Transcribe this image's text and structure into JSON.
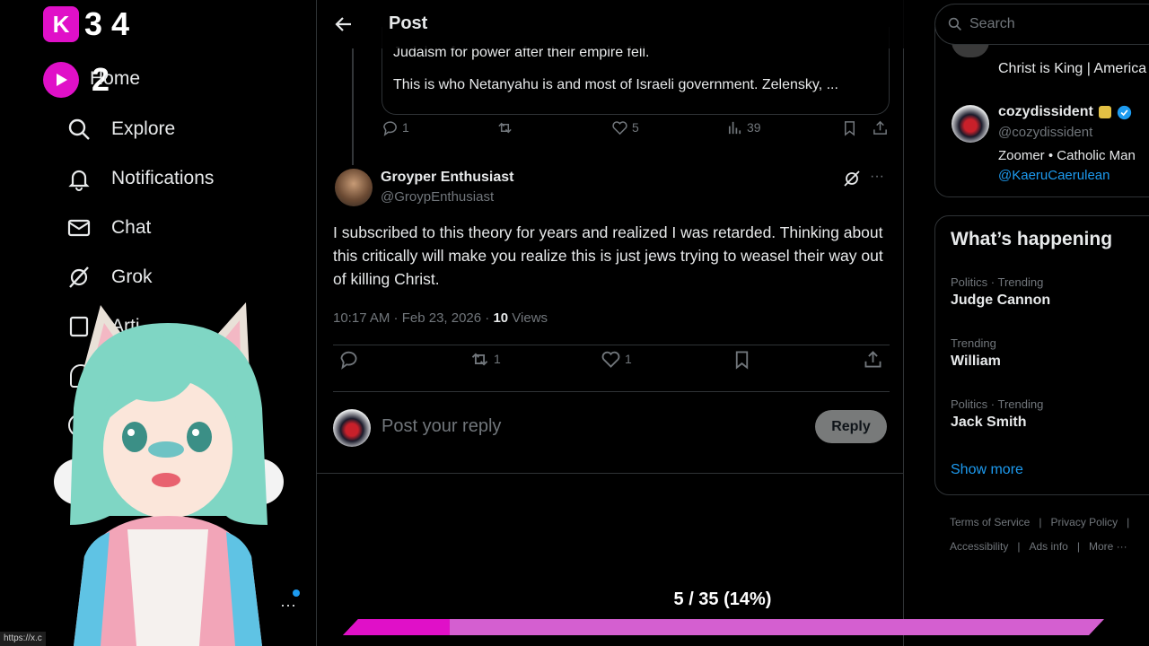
{
  "overlay": {
    "counter_top": "3 4",
    "counter_bottom": "2",
    "badge_top_letter": "K",
    "accent_magenta": "#e010c8"
  },
  "nav": {
    "items": [
      {
        "label": "Home",
        "icon": "home-icon"
      },
      {
        "label": "Explore",
        "icon": "search-icon"
      },
      {
        "label": "Notifications",
        "icon": "bell-icon"
      },
      {
        "label": "Chat",
        "icon": "envelope-icon"
      },
      {
        "label": "Grok",
        "icon": "grok-icon"
      },
      {
        "label": "Arti",
        "icon": "article-icon"
      }
    ],
    "status_url": "https://x.c"
  },
  "header": {
    "title": "Post"
  },
  "quoted": {
    "line1": "Judaism for power after their empire fell.",
    "line2": "This is who Netanyahu is and most of Israeli government. Zelensky, ..."
  },
  "parent_actions": {
    "replies": "1",
    "likes": "5",
    "views": "39"
  },
  "tweet": {
    "display_name": "Groyper Enthusiast",
    "handle": "@GroypEnthusiast",
    "text": "I subscribed to this theory for years and realized I was retarded. Thinking about this critically will make you realize this is just jews trying to weasel their way out of killing Christ.",
    "timestamp": "10:17 AM · Feb 23, 2026 · ",
    "views_count": "10",
    "views_label": " Views",
    "reposts": "1",
    "likes": "1"
  },
  "reply": {
    "placeholder": "Post your reply",
    "button": "Reply"
  },
  "search": {
    "placeholder": "Search"
  },
  "who_to_follow": {
    "partial_bio": "Christ is King | America",
    "name": "cozydissident",
    "handle": "@cozydissident",
    "bio": "Zoomer • Catholic Man",
    "mention": "@KaeruCaerulean"
  },
  "happening": {
    "title": "What’s happening",
    "trends": [
      {
        "category": "Politics · Trending",
        "name": "Judge Cannon"
      },
      {
        "category": "Trending",
        "name": "William"
      },
      {
        "category": "Politics · Trending",
        "name": "Jack Smith"
      }
    ],
    "show_more": "Show more"
  },
  "footer": {
    "links_row1": [
      "Terms of Service",
      "Privacy Policy"
    ],
    "links_row2": [
      "Accessibility",
      "Ads info",
      "More ···"
    ]
  },
  "progress": {
    "label": "5 / 35 (14%)",
    "fraction": 0.14
  }
}
